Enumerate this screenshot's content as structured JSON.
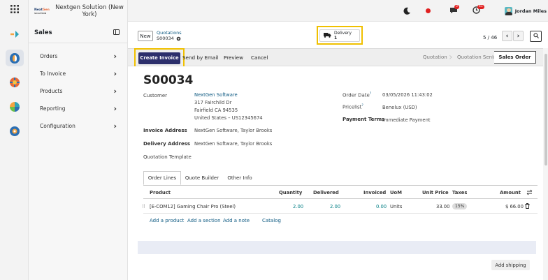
{
  "company": {
    "logo_text": "NextGen SOLUTION",
    "name": "Nextgen Solution (New York)"
  },
  "sidebar": {
    "app_title": "Sales",
    "items": [
      {
        "label": "Orders"
      },
      {
        "label": "To Invoice"
      },
      {
        "label": "Products"
      },
      {
        "label": "Reporting"
      },
      {
        "label": "Configuration"
      }
    ]
  },
  "topbar": {
    "user": "Jordan Miles",
    "activity_badge": "4",
    "messages_badge": "3",
    "bell_badge": "41"
  },
  "control": {
    "new_label": "New",
    "breadcrumb_parent": "Quotations",
    "breadcrumb_current": "S00034",
    "delivery_label": "Delivery",
    "delivery_count": "1",
    "pager": "5 / 46"
  },
  "actions": {
    "create_invoice": "Create Invoice",
    "send_email": "Send by Email",
    "preview": "Preview",
    "cancel": "Cancel"
  },
  "stages": {
    "quotation": "Quotation",
    "sent": "Quotation Sent",
    "active": "Sales Order"
  },
  "form": {
    "title": "S00034",
    "customer_label": "Customer",
    "customer_name": "NextGen Software",
    "customer_addr1": "317 Fairchild Dr",
    "customer_addr2": "Fairfield CA 94535",
    "customer_addr3": "United States – US12345674",
    "invoice_addr_label": "Invoice Address",
    "invoice_addr": "NextGen Software, Taylor Brooks",
    "delivery_addr_label": "Delivery Address",
    "delivery_addr": "NextGen Software, Taylor Brooks",
    "template_label": "Quotation Template",
    "order_date_label": "Order Date",
    "order_date": "03/05/2026 11:43:02",
    "pricelist_label": "Pricelist",
    "pricelist": "Benelux (USD)",
    "terms_label": "Payment Terms",
    "terms": "Immediate Payment",
    "help_mark": "?"
  },
  "tabs": {
    "order_lines": "Order Lines",
    "quote_builder": "Quote Builder",
    "other_info": "Other Info"
  },
  "table": {
    "headers": {
      "product": "Product",
      "quantity": "Quantity",
      "delivered": "Delivered",
      "invoiced": "Invoiced",
      "uom": "UoM",
      "unit_price": "Unit Price",
      "taxes": "Taxes",
      "amount": "Amount"
    },
    "row": {
      "product": "[E-COM12] Gaming Chair Pro (Steel)",
      "quantity": "2.00",
      "delivered": "2.00",
      "invoiced": "0.00",
      "uom": "Units",
      "unit_price": "33.00",
      "taxes": "15%",
      "amount": "$ 66.00"
    },
    "add_product": "Add a product",
    "add_section": "Add a section",
    "add_note": "Add a note",
    "catalog": "Catalog"
  },
  "add_shipping": "Add shipping",
  "colors": {
    "brand": "#2c2f6b",
    "link": "#0e5a82",
    "highlight": "#f0c000",
    "teal": "#017e84"
  }
}
